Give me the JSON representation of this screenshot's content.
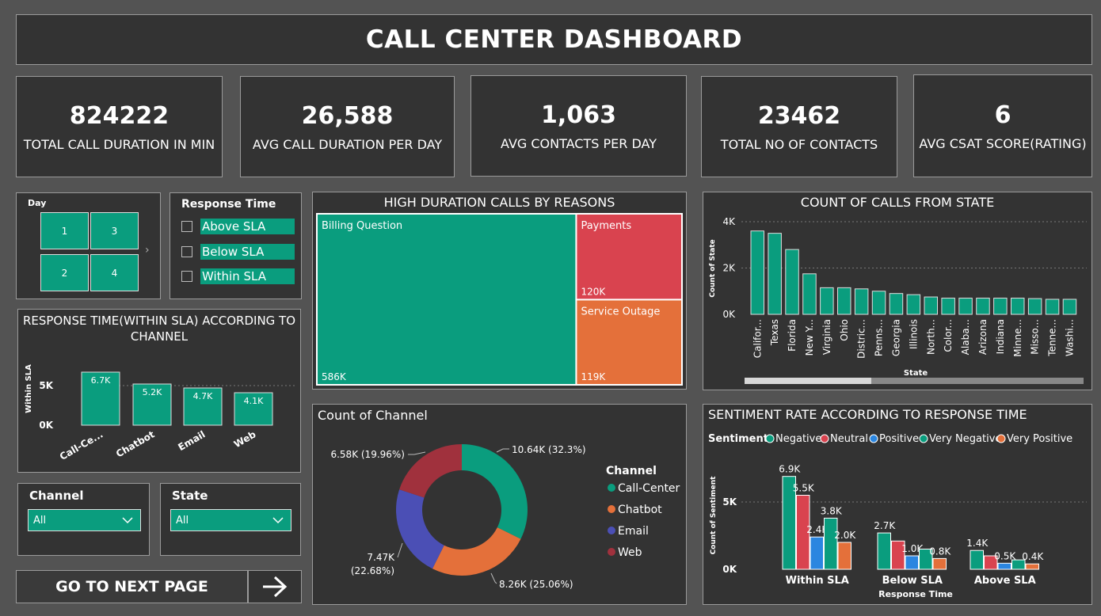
{
  "title": "CALL CENTER DASHBOARD",
  "kpis": [
    {
      "value": "824222",
      "label": "TOTAL CALL DURATION IN MIN"
    },
    {
      "value": "26,588",
      "label": "AVG CALL DURATION PER DAY"
    },
    {
      "value": "1,063",
      "label": "AVG CONTACTS  PER DAY"
    },
    {
      "value": "23462",
      "label": "TOTAL NO OF CONTACTS"
    },
    {
      "value": "6",
      "label": "AVG CSAT SCORE(RATING)"
    }
  ],
  "day_slicer": {
    "header": "Day",
    "items": [
      "1",
      "3",
      "2",
      "4"
    ]
  },
  "response_slicer": {
    "header": "Response Time",
    "items": [
      "Above SLA",
      "Below SLA",
      "Within SLA"
    ]
  },
  "channel_filter": {
    "header": "Channel",
    "value": "All"
  },
  "state_filter": {
    "header": "State",
    "value": "All"
  },
  "next_button": {
    "label": "GO TO NEXT PAGE"
  },
  "colors": {
    "teal": "#0a9d7e",
    "red": "#d9434f",
    "orange": "#e4703a",
    "blue": "#4b4fb5",
    "darkred": "#a0313d",
    "sky": "#2b86e0",
    "bg": "#333333"
  },
  "chart_data": [
    {
      "id": "sla_channel",
      "type": "bar",
      "title": "RESPONSE TIME(WITHIN SLA) ACCORDING TO CHANNEL",
      "ylabel": "Within SLA",
      "categories": [
        "Call-Ce...",
        "Chatbot",
        "Email",
        "Web"
      ],
      "values": [
        6.7,
        5.2,
        4.7,
        4.1
      ],
      "data_labels": [
        "6.7K",
        "5.2K",
        "4.7K",
        "4.1K"
      ],
      "yticks": [
        "0K",
        "5K"
      ],
      "ylim": [
        0,
        7
      ]
    },
    {
      "id": "treemap",
      "type": "treemap",
      "title": "HIGH DURATION CALLS BY REASONS",
      "categories": [
        "Billing Question",
        "Payments",
        "Service Outage"
      ],
      "values": [
        586,
        120,
        119
      ],
      "data_labels": [
        "586K",
        "120K",
        "119K"
      ]
    },
    {
      "id": "state_calls",
      "type": "bar",
      "title": "COUNT OF CALLS FROM STATE",
      "xlabel": "State",
      "ylabel": "Count of State",
      "categories": [
        "Califor...",
        "Texas",
        "Florida",
        "New Y...",
        "Virginia",
        "Ohio",
        "Distric...",
        "Penns...",
        "Georgia",
        "Illinois",
        "North...",
        "Color...",
        "Alaba...",
        "Arizona",
        "Indiana",
        "Minne...",
        "Misso...",
        "Tenne...",
        "Washi..."
      ],
      "values": [
        3600,
        3500,
        2800,
        1750,
        1150,
        1150,
        1100,
        1000,
        900,
        850,
        750,
        700,
        700,
        700,
        700,
        700,
        680,
        650,
        650
      ],
      "yticks": [
        "0K",
        "2K",
        "4K"
      ],
      "ylim": [
        0,
        4000
      ]
    },
    {
      "id": "channel_donut",
      "type": "pie",
      "title": "Count of Channel",
      "legend_title": "Channel",
      "categories": [
        "Call-Center",
        "Chatbot",
        "Email",
        "Web"
      ],
      "values": [
        10.64,
        8.26,
        7.47,
        6.58
      ],
      "percents": [
        32.3,
        25.06,
        22.68,
        19.96
      ],
      "data_labels": [
        "10.64K (32.3%)",
        "8.26K (25.06%)",
        "7.47K",
        "(22.68%)",
        "6.58K (19.96%)"
      ]
    },
    {
      "id": "sentiment",
      "type": "bar",
      "title": "SENTIMENT RATE ACCORDING TO RESPONSE TIME",
      "legend_title": "Sentiment",
      "xlabel": "Response Time",
      "ylabel": "Count of Sentiment",
      "categories": [
        "Within SLA",
        "Below SLA",
        "Above SLA"
      ],
      "series": [
        {
          "name": "Negative",
          "values": [
            6.9,
            2.7,
            1.4
          ],
          "labels": [
            "6.9K",
            "2.7K",
            "1.4K"
          ]
        },
        {
          "name": "Neutral",
          "values": [
            5.5,
            2.1,
            1.0
          ],
          "labels": [
            "5.5K",
            "",
            ""
          ]
        },
        {
          "name": "Positive",
          "values": [
            2.4,
            1.0,
            0.45
          ],
          "labels": [
            "2.4K",
            "1.0K",
            "0.5K"
          ]
        },
        {
          "name": "Very Negative",
          "values": [
            3.8,
            1.5,
            0.7
          ],
          "labels": [
            "3.8K",
            "",
            ""
          ]
        },
        {
          "name": "Very Positive",
          "values": [
            2.0,
            0.8,
            0.4
          ],
          "labels": [
            "2.0K",
            "0.8K",
            "0.4K"
          ]
        }
      ],
      "yticks": [
        "0K",
        "5K"
      ],
      "ylim": [
        0,
        7.5
      ]
    }
  ]
}
